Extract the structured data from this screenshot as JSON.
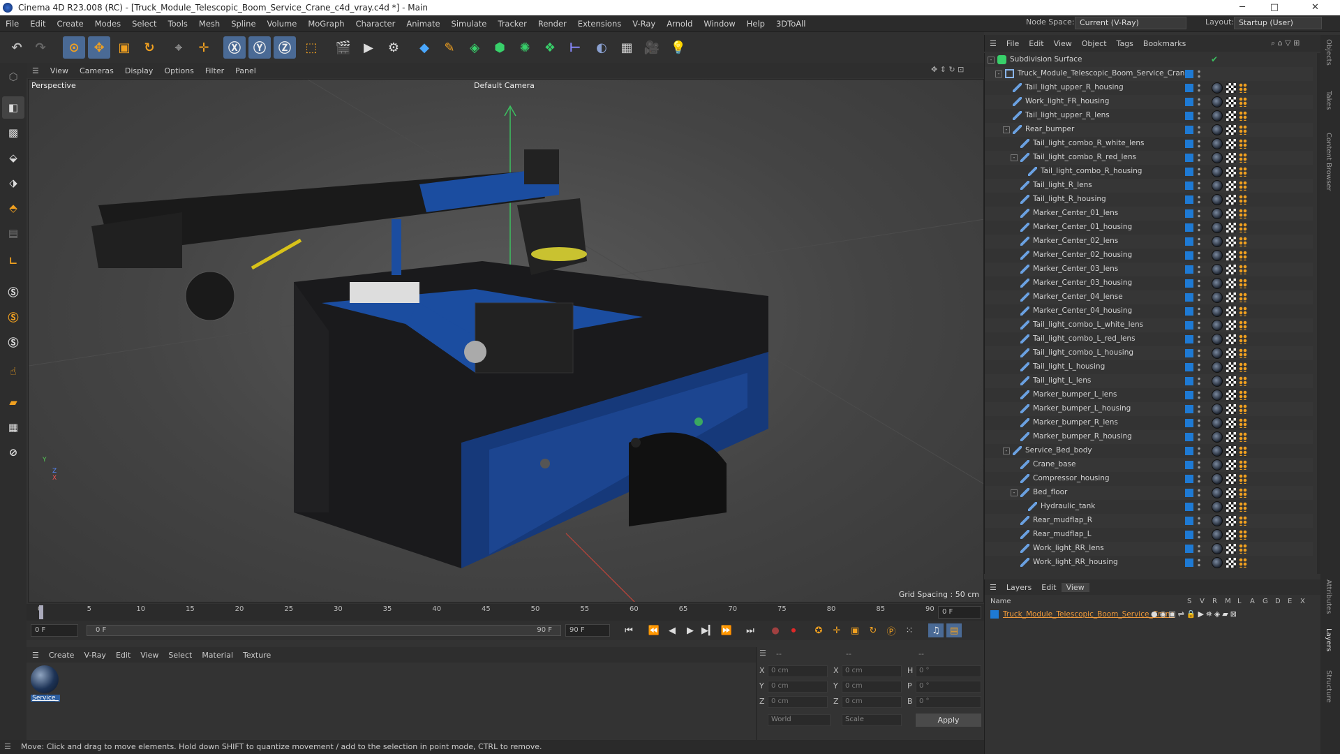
{
  "window": {
    "title": "Cinema 4D R23.008 (RC) - [Truck_Module_Telescopic_Boom_Service_Crane_c4d_vray.c4d *] - Main",
    "minimize": "─",
    "maximize": "□",
    "close": "✕"
  },
  "menubar": {
    "items": [
      "File",
      "Edit",
      "Create",
      "Modes",
      "Select",
      "Tools",
      "Mesh",
      "Spline",
      "Volume",
      "MoGraph",
      "Character",
      "Animate",
      "Simulate",
      "Tracker",
      "Render",
      "Extensions",
      "V-Ray",
      "Arnold",
      "Window",
      "Help",
      "3DToAll"
    ],
    "node_space_label": "Node Space:",
    "node_space_value": "Current (V-Ray)",
    "layout_label": "Layout:",
    "layout_value": "Startup (User)"
  },
  "viewport": {
    "menu": [
      "View",
      "Cameras",
      "Display",
      "Options",
      "Filter",
      "Panel"
    ],
    "name": "Perspective",
    "camera": "Default Camera",
    "grid_spacing": "Grid Spacing : 50 cm",
    "axis_y": "Y",
    "axis_z": "Z",
    "axis_x": "X"
  },
  "timeline": {
    "ticks": [
      "0",
      "5",
      "10",
      "15",
      "20",
      "25",
      "30",
      "35",
      "40",
      "45",
      "50",
      "55",
      "60",
      "65",
      "70",
      "75",
      "80",
      "85",
      "90"
    ],
    "current_frame": "0 F",
    "start_field": "0 F",
    "range_start": "0 F",
    "range_end": "90 F",
    "end_field": "90 F"
  },
  "material_manager": {
    "menu": [
      "Create",
      "V-Ray",
      "Edit",
      "View",
      "Select",
      "Material",
      "Texture"
    ],
    "material_name": "Service_"
  },
  "coordinates": {
    "header": [
      "--",
      "--",
      "--"
    ],
    "rows": [
      {
        "axis": "X",
        "pos": "0 cm",
        "axis2": "X",
        "size": "0 cm",
        "axis3": "H",
        "rot": "0 °"
      },
      {
        "axis": "Y",
        "pos": "0 cm",
        "axis2": "Y",
        "size": "0 cm",
        "axis3": "P",
        "rot": "0 °"
      },
      {
        "axis": "Z",
        "pos": "0 cm",
        "axis2": "Z",
        "size": "0 cm",
        "axis3": "B",
        "rot": "0 °"
      }
    ],
    "mode1": "World",
    "mode2": "Scale",
    "apply": "Apply"
  },
  "statusbar": {
    "text": "Move: Click and drag to move elements. Hold down SHIFT to quantize movement / add to the selection in point mode, CTRL to remove."
  },
  "object_manager": {
    "menu": [
      "File",
      "Edit",
      "View",
      "Object",
      "Tags",
      "Bookmarks"
    ],
    "objects": [
      {
        "name": "Subdivision Surface",
        "depth": 0,
        "expand": "-",
        "kind": "subdiv"
      },
      {
        "name": "Truck_Module_Telescopic_Boom_Service_Crane",
        "depth": 1,
        "expand": "-",
        "kind": "null"
      },
      {
        "name": "Tail_light_upper_R_housing",
        "depth": 2,
        "expand": "",
        "kind": "poly"
      },
      {
        "name": "Work_light_FR_housing",
        "depth": 2,
        "expand": "",
        "kind": "poly"
      },
      {
        "name": "Tail_light_upper_R_lens",
        "depth": 2,
        "expand": "",
        "kind": "poly"
      },
      {
        "name": "Rear_bumper",
        "depth": 2,
        "expand": "-",
        "kind": "poly"
      },
      {
        "name": "Tail_light_combo_R_white_lens",
        "depth": 3,
        "expand": "",
        "kind": "poly"
      },
      {
        "name": "Tail_light_combo_R_red_lens",
        "depth": 3,
        "expand": "-",
        "kind": "poly"
      },
      {
        "name": "Tail_light_combo_R_housing",
        "depth": 4,
        "expand": "",
        "kind": "poly"
      },
      {
        "name": "Tail_light_R_lens",
        "depth": 3,
        "expand": "",
        "kind": "poly"
      },
      {
        "name": "Tail_light_R_housing",
        "depth": 3,
        "expand": "",
        "kind": "poly"
      },
      {
        "name": "Marker_Center_01_lens",
        "depth": 3,
        "expand": "",
        "kind": "poly"
      },
      {
        "name": "Marker_Center_01_housing",
        "depth": 3,
        "expand": "",
        "kind": "poly"
      },
      {
        "name": "Marker_Center_02_lens",
        "depth": 3,
        "expand": "",
        "kind": "poly"
      },
      {
        "name": "Marker_Center_02_housing",
        "depth": 3,
        "expand": "",
        "kind": "poly"
      },
      {
        "name": "Marker_Center_03_lens",
        "depth": 3,
        "expand": "",
        "kind": "poly"
      },
      {
        "name": "Marker_Center_03_housing",
        "depth": 3,
        "expand": "",
        "kind": "poly"
      },
      {
        "name": "Marker_Center_04_lense",
        "depth": 3,
        "expand": "",
        "kind": "poly"
      },
      {
        "name": "Marker_Center_04_housing",
        "depth": 3,
        "expand": "",
        "kind": "poly"
      },
      {
        "name": "Tail_light_combo_L_white_lens",
        "depth": 3,
        "expand": "",
        "kind": "poly"
      },
      {
        "name": "Tail_light_combo_L_red_lens",
        "depth": 3,
        "expand": "",
        "kind": "poly"
      },
      {
        "name": "Tail_light_combo_L_housing",
        "depth": 3,
        "expand": "",
        "kind": "poly"
      },
      {
        "name": "Tail_light_L_housing",
        "depth": 3,
        "expand": "",
        "kind": "poly"
      },
      {
        "name": "Tail_light_L_lens",
        "depth": 3,
        "expand": "",
        "kind": "poly"
      },
      {
        "name": "Marker_bumper_L_lens",
        "depth": 3,
        "expand": "",
        "kind": "poly"
      },
      {
        "name": "Marker_bumper_L_housing",
        "depth": 3,
        "expand": "",
        "kind": "poly"
      },
      {
        "name": "Marker_bumper_R_lens",
        "depth": 3,
        "expand": "",
        "kind": "poly"
      },
      {
        "name": "Marker_bumper_R_housing",
        "depth": 3,
        "expand": "",
        "kind": "poly"
      },
      {
        "name": "Service_Bed_body",
        "depth": 2,
        "expand": "-",
        "kind": "poly"
      },
      {
        "name": "Crane_base",
        "depth": 3,
        "expand": "",
        "kind": "poly"
      },
      {
        "name": "Compressor_housing",
        "depth": 3,
        "expand": "",
        "kind": "poly"
      },
      {
        "name": "Bed_floor",
        "depth": 3,
        "expand": "-",
        "kind": "poly"
      },
      {
        "name": "Hydraulic_tank",
        "depth": 4,
        "expand": "",
        "kind": "poly"
      },
      {
        "name": "Rear_mudflap_R",
        "depth": 3,
        "expand": "",
        "kind": "poly"
      },
      {
        "name": "Rear_mudflap_L",
        "depth": 3,
        "expand": "",
        "kind": "poly"
      },
      {
        "name": "Work_light_RR_lens",
        "depth": 3,
        "expand": "",
        "kind": "poly"
      },
      {
        "name": "Work_light_RR_housing",
        "depth": 3,
        "expand": "",
        "kind": "poly"
      }
    ]
  },
  "layers": {
    "menu": [
      "Layers",
      "Edit",
      "View"
    ],
    "cols": [
      "S",
      "V",
      "R",
      "M",
      "L",
      "A",
      "G",
      "D",
      "E",
      "X"
    ],
    "name_header": "Name",
    "layer_name": "Truck_Module_Telescopic_Boom_Service_Crane"
  },
  "side_tabs": [
    "Objects",
    "Takes",
    "Content Browser",
    "Attributes",
    "Layers",
    "Structure"
  ],
  "colors": {
    "accent_blue": "#1e7ad4",
    "orange": "#f0a020",
    "selected_text": "#f09a3a"
  }
}
